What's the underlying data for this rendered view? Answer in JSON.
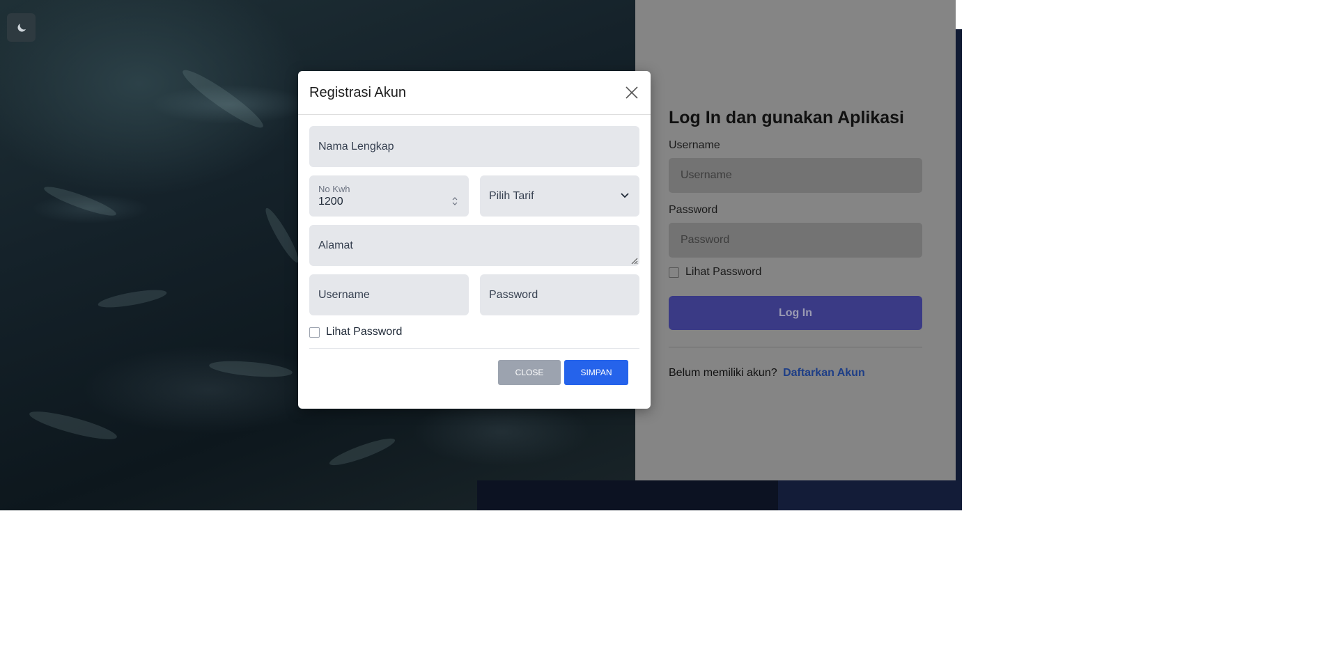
{
  "theme_toggle": {
    "icon": "moon-icon"
  },
  "login": {
    "title": "Log In dan gunakan Aplikasi",
    "username_label": "Username",
    "username_placeholder": "Username",
    "password_label": "Password",
    "password_placeholder": "Password",
    "show_password_label": "Lihat Password",
    "submit_label": "Log In",
    "no_account_text": "Belum memiliki akun?",
    "register_link": "Daftarkan Akun"
  },
  "modal": {
    "title": "Registrasi Akun",
    "close_icon": "close-icon",
    "full_name_placeholder": "Nama Lengkap",
    "kwh_label": "No Kwh",
    "kwh_value": "1200",
    "tarif_placeholder": "Pilih Tarif",
    "address_placeholder": "Alamat",
    "username_placeholder": "Username",
    "password_placeholder": "Password",
    "show_password_label": "Lihat Password",
    "close_button": "Close",
    "save_button": "Simpan"
  },
  "colors": {
    "primary": "#2563eb",
    "login_button": "#3a3a85",
    "link": "#1e3e86",
    "secondary_button": "#9ca3af"
  }
}
